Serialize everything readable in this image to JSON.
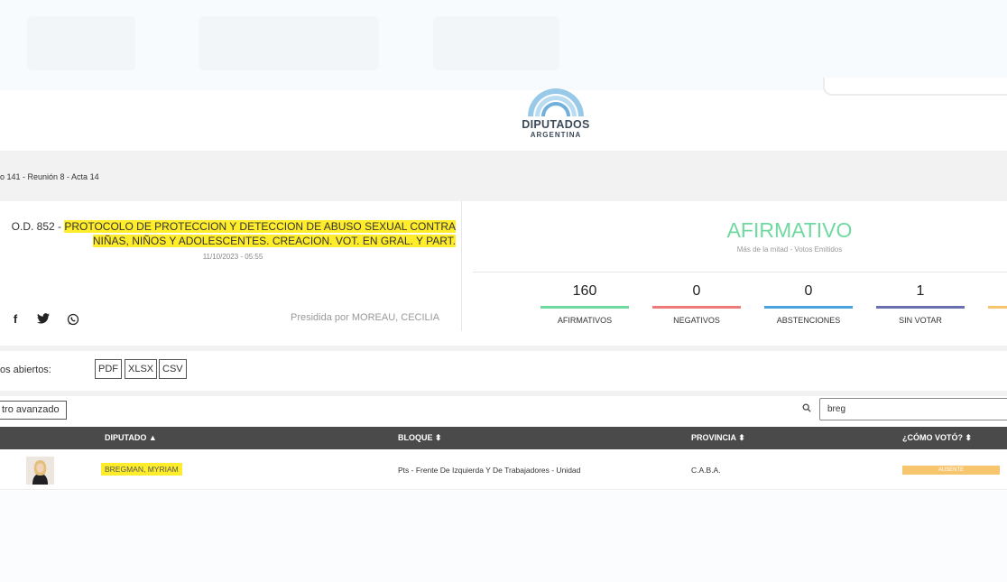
{
  "logo": {
    "name": "DIPUTADOS",
    "country": "ARGENTINA"
  },
  "breadcrumb": "o 141 - Reunión 8 - Acta 14",
  "order": {
    "prefix": "O.D. 852 - ",
    "title_line1": "PROTOCOLO DE PROTECCION Y DETECCION DE ABUSO SEXUAL CONTRA",
    "title_line2": "NIÑAS, NIÑOS Y ADOLESCENTES. CREACION. VOT. EN GRAL. Y PART.",
    "datetime": "11/10/2023 - 05:55",
    "presided": "Presidida por MOREAU, CECILIA"
  },
  "result": {
    "label": "AFIRMATIVO",
    "subtitle": "Más de la mitad - Votos Emitidos",
    "color": "#6fd9a0"
  },
  "stats": [
    {
      "value": "160",
      "label": "AFIRMATIVOS",
      "color": "#6fd9a0"
    },
    {
      "value": "0",
      "label": "NEGATIVOS",
      "color": "#f07a7a"
    },
    {
      "value": "0",
      "label": "ABSTENCIONES",
      "color": "#4aa3df"
    },
    {
      "value": "1",
      "label": "SIN VOTAR",
      "color": "#6a6fb0"
    }
  ],
  "open_data": {
    "label": "os abiertos:",
    "pdf": "PDF",
    "xlsx": "XLSX",
    "csv": "CSV"
  },
  "filter": {
    "advanced": "tro avanzado",
    "search_value": "breg"
  },
  "table": {
    "headers": {
      "diputado": "DIPUTADO",
      "bloque": "BLOQUE",
      "provincia": "PROVINCIA",
      "voto": "¿CÓMO VOTÓ?"
    },
    "rows": [
      {
        "name": "BREGMAN, MYRIAM",
        "bloque": "Pts - Frente De Izquierda Y De Trabajadores - Unidad",
        "provincia": "C.A.B.A.",
        "voto": "AUSENTE"
      }
    ]
  },
  "colors": {
    "highlight": "#ffed2b",
    "header_bg": "#4a4a4a",
    "absent": "#f7c56e"
  }
}
